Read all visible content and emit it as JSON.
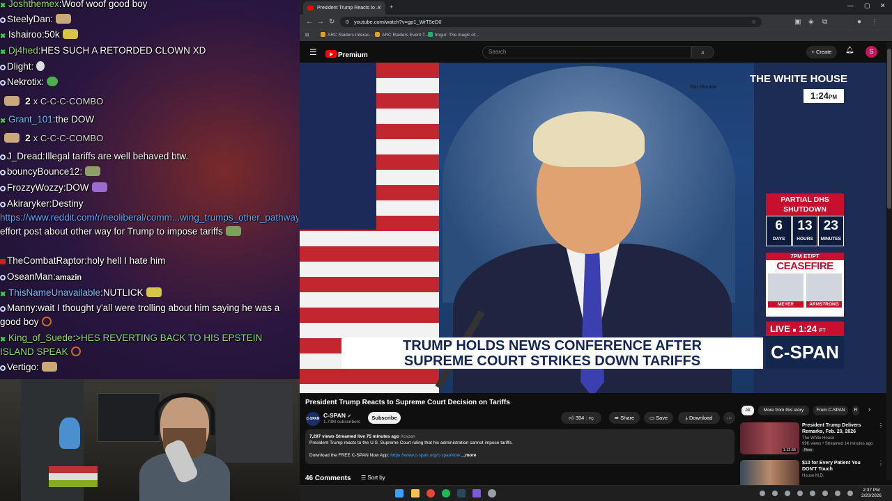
{
  "chat": {
    "lines": [
      {
        "user": "Joshthemex",
        "msg": "Woof woof good boy",
        "badge": "x"
      },
      {
        "user": "SteelyDan",
        "msg": "",
        "badge": "dot"
      },
      {
        "user": "Ishairoo",
        "msg": "50k",
        "badge": "x"
      },
      {
        "user": "Dj4hed",
        "msg": "HES SUCH A RETORDED CLOWN XD",
        "badge": "x"
      },
      {
        "user": "Dlight",
        "msg": "",
        "badge": "dot"
      },
      {
        "user": "Nekrotix",
        "msg": "",
        "badge": "dot"
      },
      {
        "combo_count": "2",
        "combo_x": "x",
        "combo_text": "C-C-C-COMBO"
      },
      {
        "user": "Grant_101",
        "msg": "the DOW",
        "badge": "x"
      },
      {
        "combo_count": "2",
        "combo_x": "x",
        "combo_text": "C-C-C-COMBO"
      },
      {
        "user": "J_Dread",
        "msg": "Illegal tariffs are well behaved btw.",
        "badge": "dot"
      },
      {
        "user": "bouncyBounce12",
        "msg": "",
        "badge": "dot"
      },
      {
        "user": "FrozzyWozzy",
        "msg": "DOW",
        "badge": "dot"
      },
      {
        "user": "Akiraryker",
        "msg": "Destiny",
        "badge": "dot"
      },
      {
        "link": "https://www.reddit.com/r/neoliberal/comm...wing_trumps_other_pathways_for_imposing/",
        "msg": " effort post about other way for Trump to impose tariffs"
      },
      {
        "user": "TheCombatRaptor",
        "msg": "holy hell I hate him",
        "badge": "red"
      },
      {
        "user": "OseanMan",
        "msg": "amazin",
        "badge": "dot"
      },
      {
        "user": "ThisNameUnavailable",
        "msg": "NUTLICK",
        "badge": "x"
      },
      {
        "user": "Manny",
        "msg": "wait I thought y'all were trolling about him saying he was a good boy",
        "badge": "dot"
      },
      {
        "user": "King_of_Suede",
        "msg": ">HES REVERTING BACK TO HIS EPSTEIN ISLAND SPEAK",
        "badge": "x"
      },
      {
        "user": "Vertigo",
        "msg": "",
        "badge": "dot"
      }
    ],
    "overlay_labels": [
      "Launcher",
      "Obsidian"
    ]
  },
  "browser": {
    "tab_title": "President Trump Reacts to ...",
    "new_tab": "+",
    "url": "youtube.com/watch?v=gp1_WrT5eD0",
    "bookmarks": [
      "ARC Raiders Interac...",
      "ARC Raiders Event T...",
      "Imgur: The magic of..."
    ],
    "window_controls": [
      "—",
      "▢",
      "✕"
    ]
  },
  "youtube": {
    "logo_text": "Premium",
    "search_placeholder": "Search",
    "create_label": "Create",
    "avatar_letter": "S",
    "video": {
      "channel_bug": "THE WHITE HOUSE",
      "bug_time": "1:24",
      "bug_time_suffix": "PM",
      "watermark": "Not Mouton",
      "dhs_title": "PARTIAL DHS SHUTDOWN",
      "dhs_days": "6",
      "dhs_days_label": "DAYS",
      "dhs_hours": "13",
      "dhs_hours_label": "HOURS",
      "dhs_minutes": "23",
      "dhs_minutes_label": "MINUTES",
      "cf_time": "7PM ET/PT",
      "cf_title": "CEASEFIRE",
      "cf_person1": "MEYER",
      "cf_person2": "ARMSTRONG",
      "live_label": "LIVE",
      "live_time": "1:24",
      "live_tz": "PT",
      "network": "C-SPAN",
      "headline1": "TRUMP HOLDS NEWS CONFERENCE AFTER",
      "headline2": "SUPREME COURT STRIKES DOWN TARIFFS"
    },
    "title": "President Trump Reacts to Supreme Court Decision on Tariffs",
    "channel": {
      "name": "C-SPAN",
      "subs": "1.73M subscribers",
      "avatar_text": "C-SPAN",
      "subscribe": "Subscribe"
    },
    "actions": {
      "likes": "354",
      "share": "Share",
      "save": "Save",
      "download": "Download"
    },
    "description": {
      "meta": "7,297 views  Streamed live 75 minutes ago",
      "tag": "#cspan",
      "text": "President Trump reacts to the U.S. Supreme Court ruling that his administration cannot impose tariffs.",
      "app_text": "Download the FREE C-SPAN Now App:",
      "app_link": "https://www.c-span.org/c-spanNow",
      "more": "...more"
    },
    "comments_label": "46 Comments",
    "sort_label": "Sort by",
    "chips": [
      "All",
      "More from this story",
      "From C-SPAN",
      "R"
    ],
    "recs": [
      {
        "title": "President Trump Delivers Remarks, Feb. 20, 2026",
        "channel": "The White House",
        "stats": "99K views • Streamed 14 minutes ago",
        "badge": "New",
        "duration": "1:12:56"
      },
      {
        "title": "$10 for Every Patient You DON'T Touch",
        "channel": "House M.D.",
        "stats": "",
        "badge": "",
        "duration": ""
      }
    ]
  },
  "taskbar": {
    "time": "2:37 PM",
    "date": "2/20/2026"
  }
}
